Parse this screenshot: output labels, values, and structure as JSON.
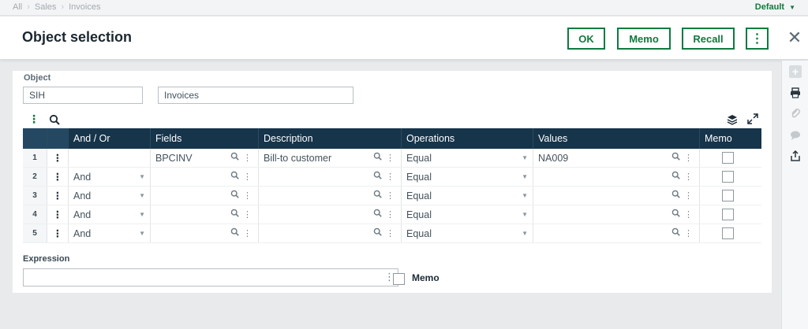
{
  "breadcrumb": [
    "All",
    "Sales",
    "Invoices"
  ],
  "profile": {
    "label": "Default"
  },
  "header": {
    "title": "Object selection",
    "ok_label": "OK",
    "memo_label": "Memo",
    "recall_label": "Recall",
    "more_label": "⋮",
    "close_label": "✕"
  },
  "object": {
    "label": "Object",
    "code": "SIH",
    "name": "Invoices"
  },
  "grid": {
    "columns": [
      "And / Or",
      "Fields",
      "Description",
      "Operations",
      "Values",
      "Memo"
    ],
    "rows": [
      {
        "num": "1",
        "andor": "",
        "field": "BPCINV",
        "description": "Bill-to customer",
        "operation": "Equal",
        "value": "NA009"
      },
      {
        "num": "2",
        "andor": "And",
        "field": "",
        "description": "",
        "operation": "Equal",
        "value": ""
      },
      {
        "num": "3",
        "andor": "And",
        "field": "",
        "description": "",
        "operation": "Equal",
        "value": ""
      },
      {
        "num": "4",
        "andor": "And",
        "field": "",
        "description": "",
        "operation": "Equal",
        "value": ""
      },
      {
        "num": "5",
        "andor": "And",
        "field": "",
        "description": "",
        "operation": "Equal",
        "value": ""
      }
    ]
  },
  "expression": {
    "label": "Expression",
    "value": "",
    "memo_label": "Memo"
  },
  "icons": {
    "toolbar": [
      "grid-menu-icon",
      "search-icon",
      "layers-icon",
      "expand-icon"
    ],
    "rightbar": [
      "plus-icon",
      "print-icon",
      "attachment-icon",
      "comment-icon",
      "share-icon"
    ]
  },
  "colors": {
    "accent": "#0f7a3e",
    "grid_header": "#16344a"
  }
}
